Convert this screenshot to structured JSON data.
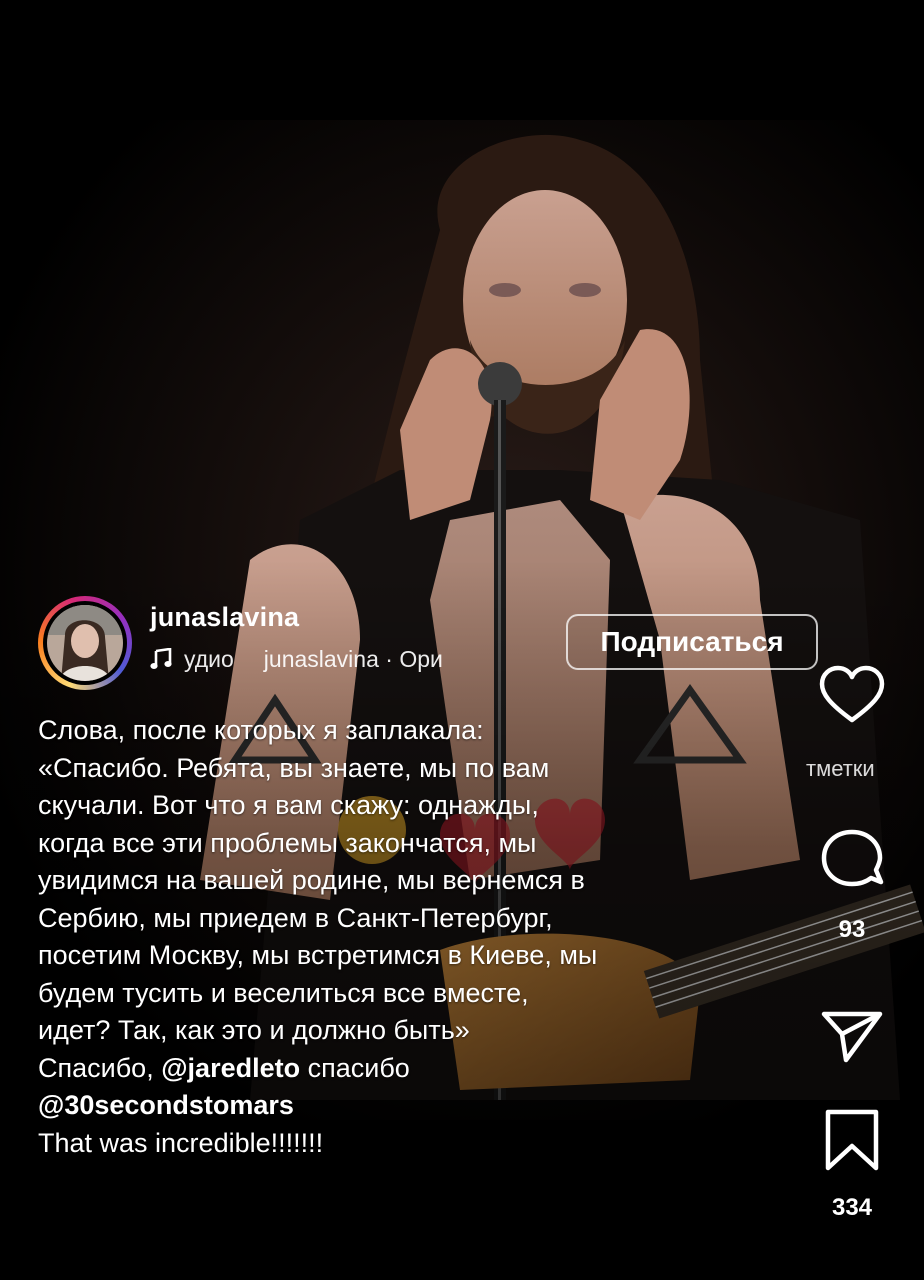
{
  "author": {
    "username": "junaslavina",
    "audio_label": "удио",
    "audio_source": "junaslavina · Ори"
  },
  "follow_button": "Подписаться",
  "actions": {
    "like_label": "тметки",
    "comments_count": "93",
    "saves_count": "334"
  },
  "caption": {
    "lines": [
      "Слова, после которых я заплакала:",
      "«Спасибо. Ребята, вы знаете, мы по вам",
      "скучали. Вот что я вам скажу: однажды,",
      "когда все эти проблемы закончатся, мы",
      "увидимся на вашей родине, мы вернемся в",
      "Сербию, мы приедем в Санкт-Петербург,",
      "посетим Москву, мы встретимся в Киеве, мы",
      "будем тусить и веселиться все вместе,",
      "идет? Так, как это и должно быть»"
    ],
    "thanks_prefix": "Спасибо,",
    "mention_1": "@jaredleto",
    "thanks_suffix": "спасибо",
    "mention_2": "@30secondstomars",
    "closing": "That was incredible!!!!!!!"
  },
  "icons": {
    "like": "heart-icon",
    "comment": "comment-icon",
    "share": "send-icon",
    "save": "bookmark-icon",
    "audio": "music-note-icon"
  },
  "colors": {
    "background": "#000000",
    "avatar_ring_start": "#feda75",
    "avatar_ring_end": "#962fbf"
  }
}
